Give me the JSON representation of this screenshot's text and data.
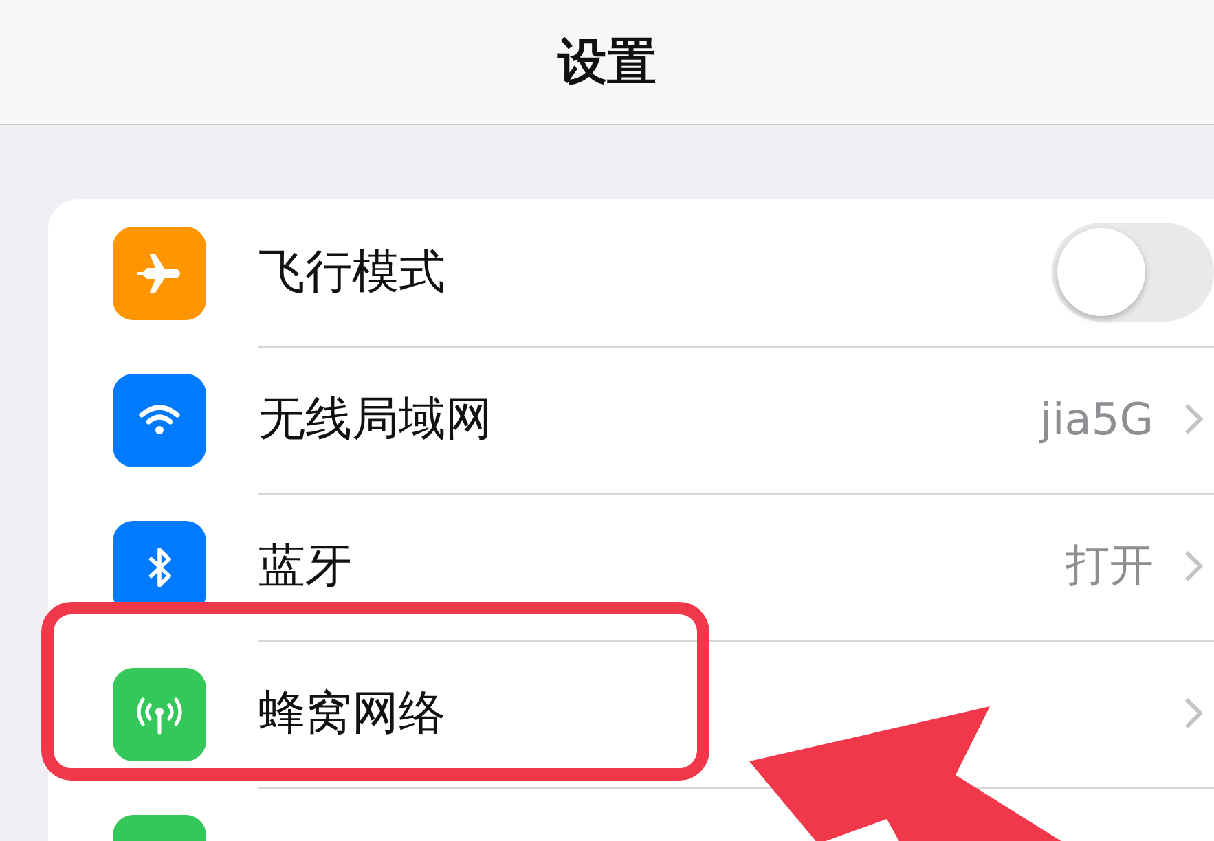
{
  "nav_bar": {
    "title": "设置"
  },
  "rows": [
    {
      "kind": "toggle",
      "color": "#ff9500",
      "label": "飞行模式",
      "on": false
    },
    {
      "kind": "link",
      "color": "#007aff",
      "label": "无线局域网",
      "value": "jia5G"
    },
    {
      "kind": "link",
      "color": "#007aff",
      "label": "蓝牙",
      "value": "打开"
    },
    {
      "kind": "link",
      "color": "#34c759",
      "label": "蜂窝网络"
    },
    {
      "kind": "link",
      "color": "#34c759"
    }
  ]
}
